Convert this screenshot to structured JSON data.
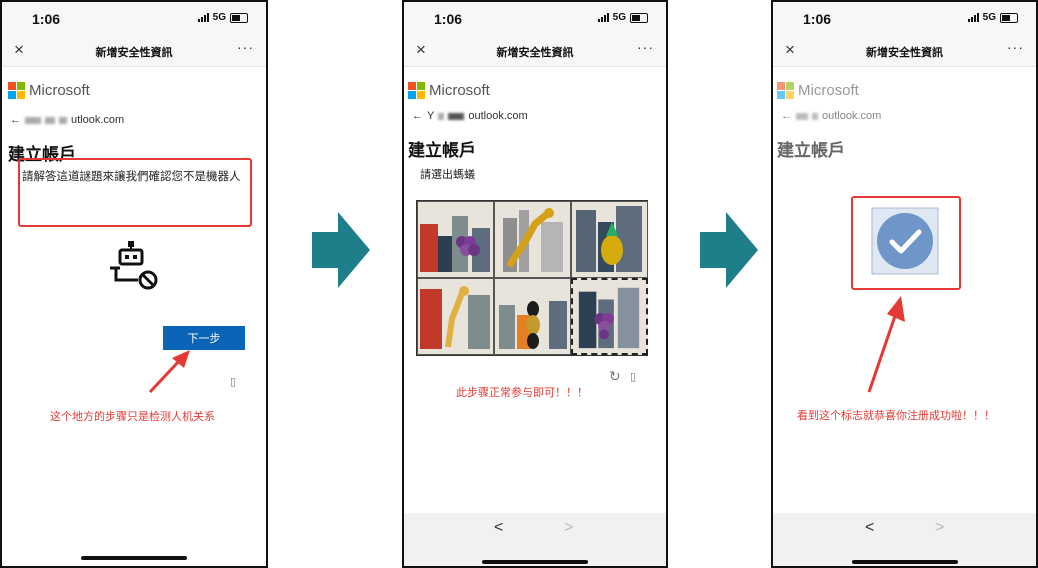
{
  "status": {
    "time": "1:06",
    "network": "5G"
  },
  "header": {
    "title": "新增安全性資訊",
    "close_icon": "close-icon",
    "more_icon": "more-icon"
  },
  "microsoft": {
    "brand": "Microsoft",
    "colors": [
      "#f25022",
      "#7fba00",
      "#00a4ef",
      "#ffb900"
    ]
  },
  "screens": [
    {
      "email_visible": "utlook.com",
      "title": "建立帳戶",
      "prompt": "請解答這道謎題來讓我們確認您不是機器人",
      "next_button": "下一步",
      "caption": "这个地方的步骤只是检测人机关系"
    },
    {
      "email_prefix": "Y",
      "email_visible": "outlook.com",
      "title": "建立帳戶",
      "instruction": "請選出螞蟻",
      "caption": "此步骤正常参与即可！！！",
      "nav": {
        "back": "<",
        "forward": ">"
      }
    },
    {
      "email_visible": "outlook.com",
      "title": "建立帳戶",
      "caption": "看到这个标志就恭喜你注册成功啦！！！",
      "nav": {
        "back": "<",
        "forward": ">"
      }
    }
  ],
  "colors": {
    "accent_red": "#e53935",
    "button_blue": "#0a64b8",
    "arrow_teal": "#1e7f8a"
  }
}
